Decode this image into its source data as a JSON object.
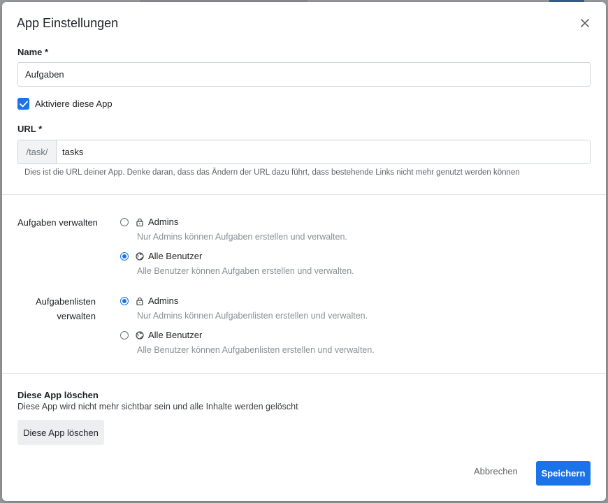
{
  "modal": {
    "title": "App Einstellungen",
    "close_icon": "close-icon"
  },
  "name_field": {
    "label": "Name *",
    "value": "Aufgaben"
  },
  "activate": {
    "label": "Aktiviere diese App",
    "checked": true
  },
  "url_field": {
    "label": "URL *",
    "prefix": "/task/",
    "value": "tasks",
    "help": "Dies ist die URL deiner App. Denke daran, dass das Ändern der URL dazu führt, dass bestehende Links nicht mehr genutzt werden können"
  },
  "permissions": {
    "manage_tasks": {
      "label": "Aufgaben verwalten",
      "options": [
        {
          "label": "Admins",
          "icon": "lock-icon",
          "desc": "Nur Admins können Aufgaben erstellen und verwalten.",
          "selected": false
        },
        {
          "label": "Alle Benutzer",
          "icon": "globe-icon",
          "desc": "Alle Benutzer können Aufgaben erstellen und verwalten.",
          "selected": true
        }
      ]
    },
    "manage_lists": {
      "label_line1": "Aufgabenlisten",
      "label_line2": "verwalten",
      "options": [
        {
          "label": "Admins",
          "icon": "lock-icon",
          "desc": "Nur Admins können Aufgabenlisten erstellen und verwalten.",
          "selected": true
        },
        {
          "label": "Alle Benutzer",
          "icon": "globe-icon",
          "desc": "Alle Benutzer können Aufgabenlisten erstellen und verwalten.",
          "selected": false
        }
      ]
    }
  },
  "danger_zone": {
    "title": "Diese App löschen",
    "description": "Diese App wird nicht mehr sichtbar sein und alle Inhalte werden gelöscht",
    "button_label": "Diese App löschen"
  },
  "footer": {
    "cancel_label": "Abbrechen",
    "save_label": "Speichern"
  },
  "colors": {
    "accent": "#1a73e8",
    "overlay": "#8c8e92"
  }
}
